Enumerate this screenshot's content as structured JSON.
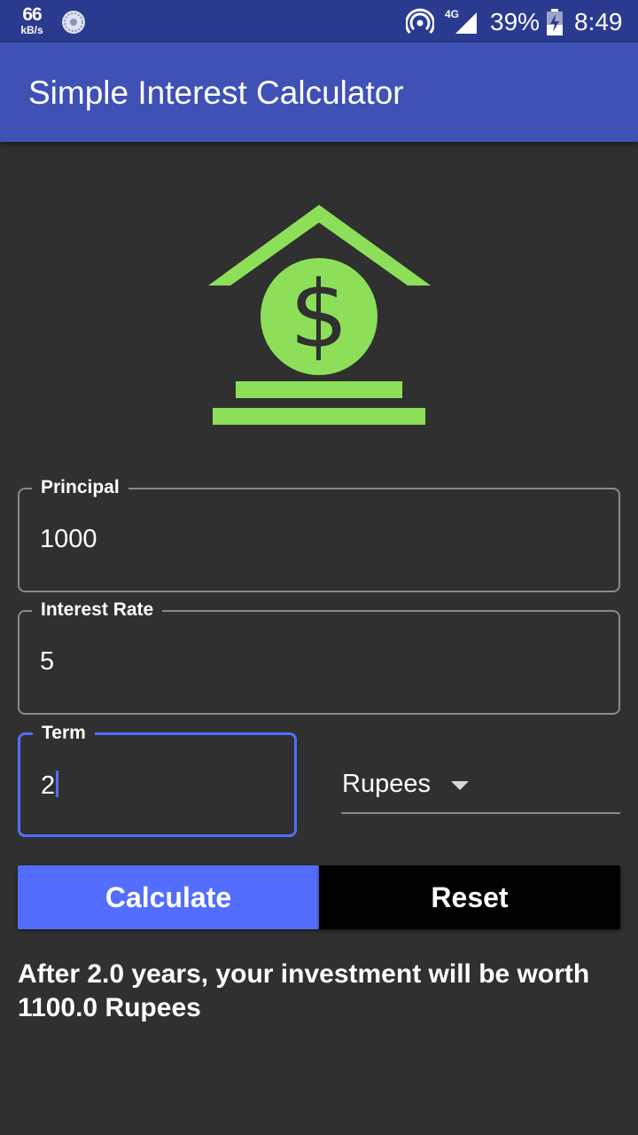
{
  "status_bar": {
    "net_speed_value": "66",
    "net_speed_unit": "kB/s",
    "network_type": "4G",
    "battery_percent": "39%",
    "time": "8:49",
    "icons": [
      "sync-icon",
      "hotspot-icon",
      "signal-icon",
      "battery-charging-icon"
    ]
  },
  "app_bar": {
    "title": "Simple Interest Calculator"
  },
  "logo": {
    "icon": "bank-dollar-icon",
    "color": "#8ddf5a"
  },
  "form": {
    "principal": {
      "label": "Principal",
      "value": "1000"
    },
    "rate": {
      "label": "Interest Rate",
      "value": "5"
    },
    "term": {
      "label": "Term",
      "value": "2"
    },
    "currency": {
      "selected": "Rupees"
    }
  },
  "buttons": {
    "calculate": "Calculate",
    "reset": "Reset"
  },
  "result": {
    "text": "After 2.0 years, your investment will be worth 1100.0 Rupees"
  },
  "colors": {
    "status_bar": "#2a3a8f",
    "app_bar": "#3f51b5",
    "background": "#303030",
    "accent": "#536dfe",
    "logo_green": "#8ddf5a"
  }
}
